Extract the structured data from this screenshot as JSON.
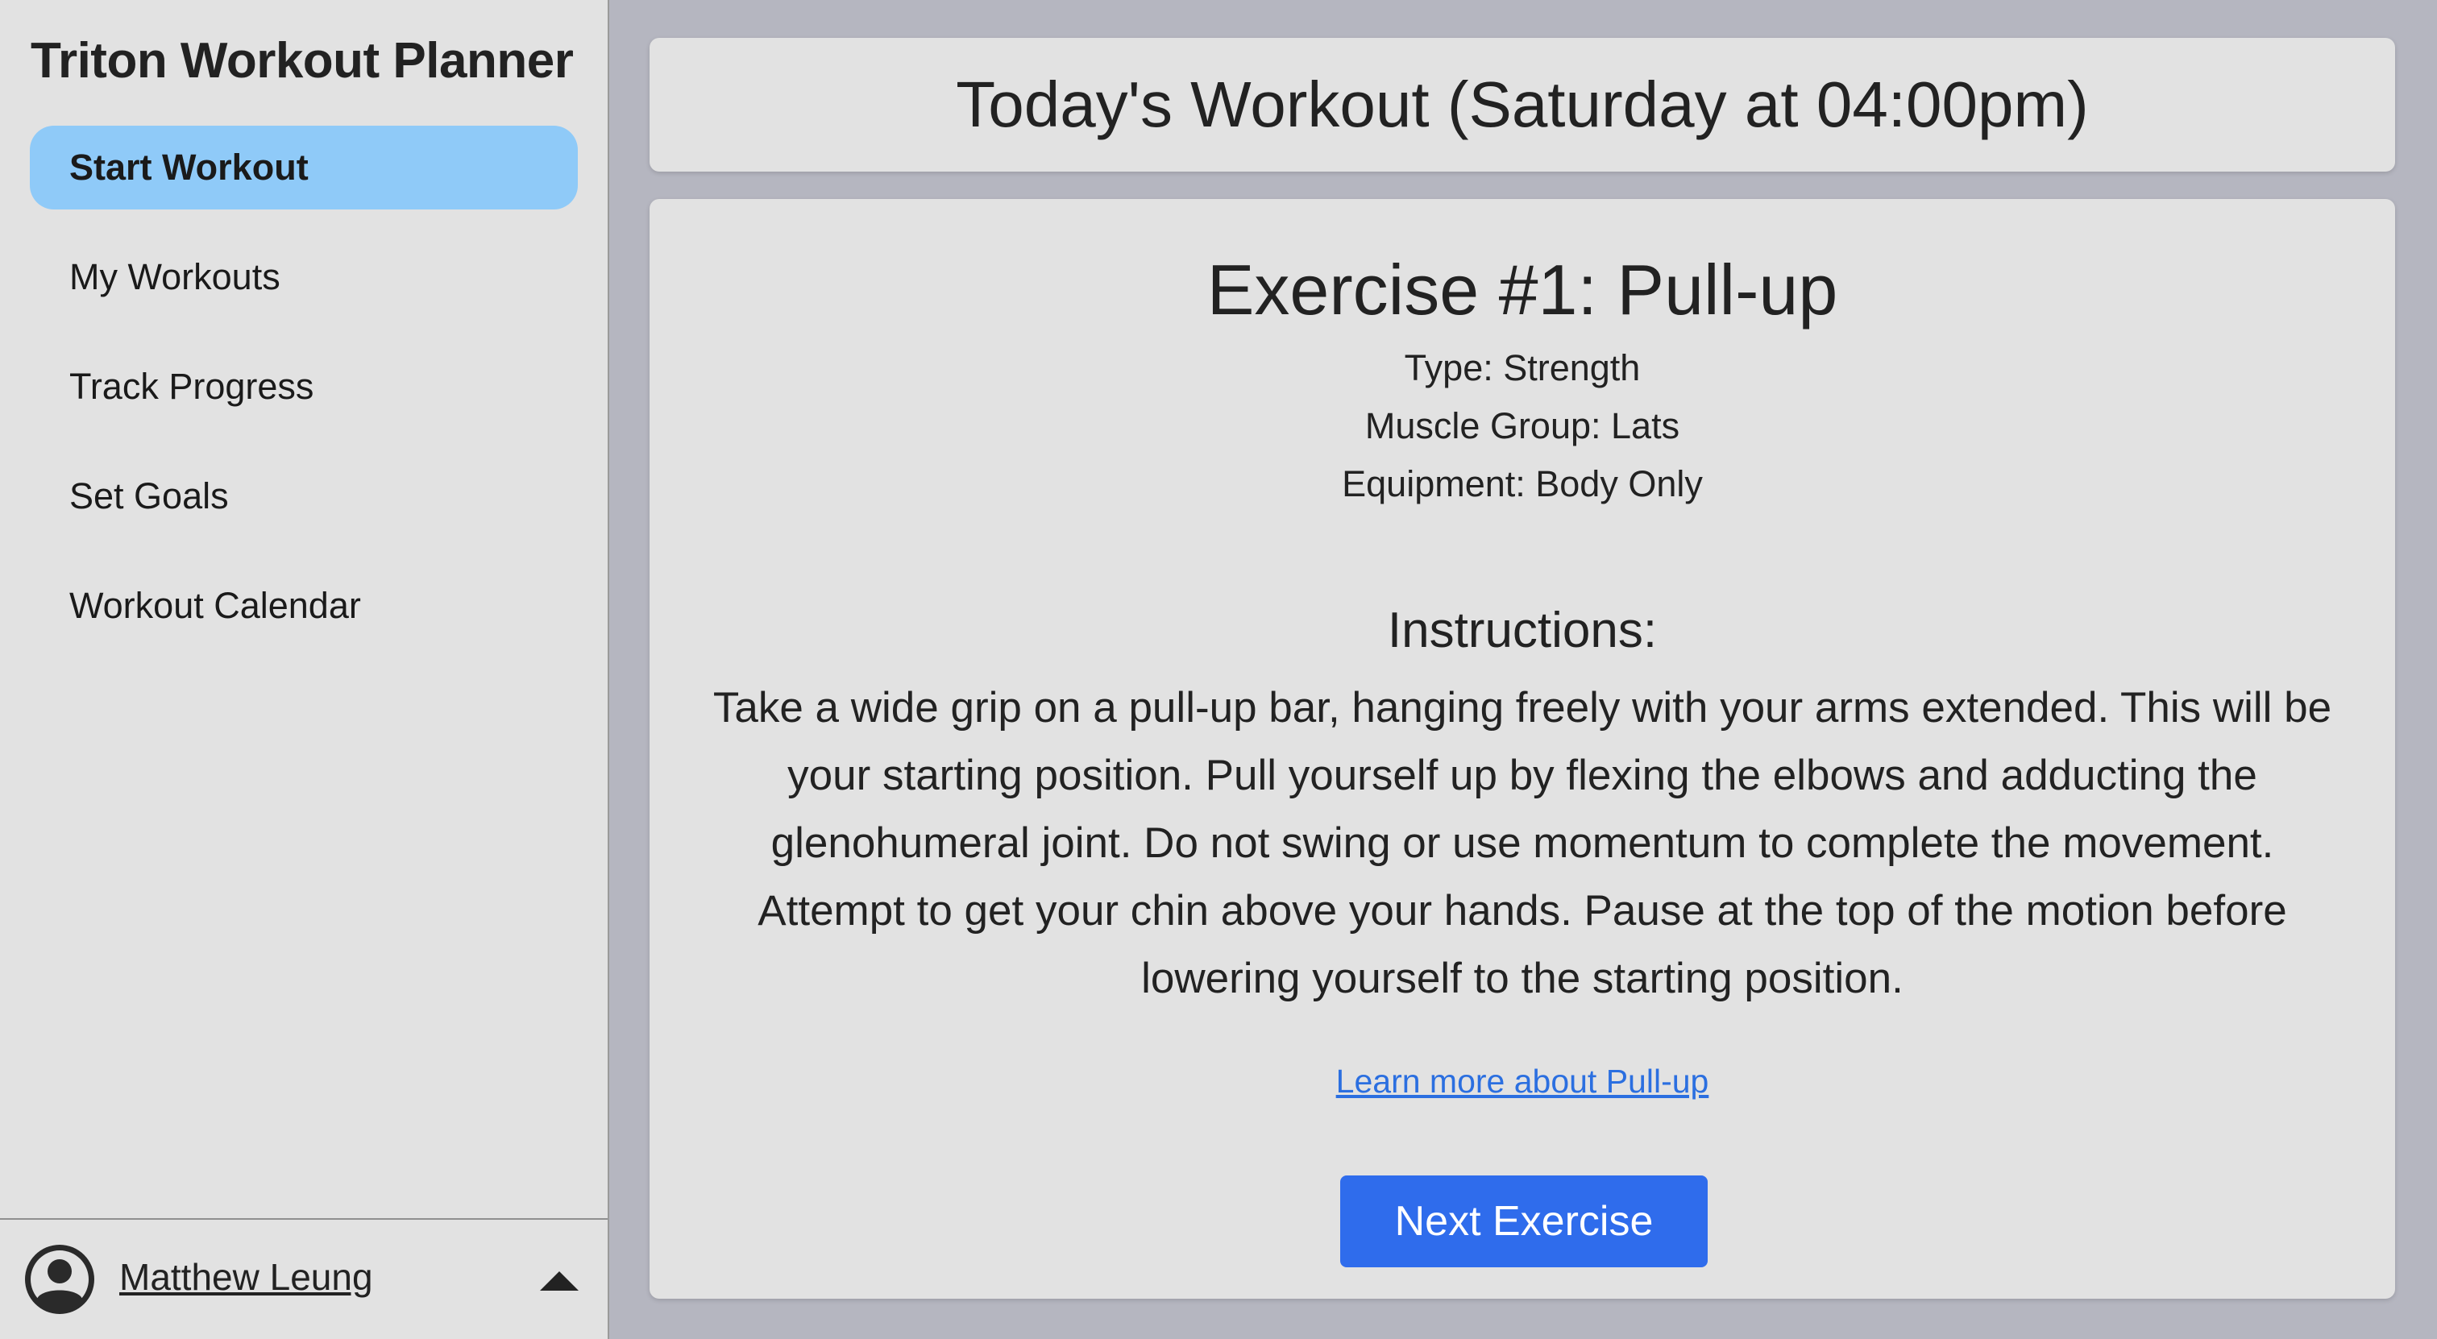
{
  "sidebar": {
    "app_title": "Triton Workout Planner",
    "items": [
      {
        "label": "Start Workout",
        "active": true
      },
      {
        "label": "My Workouts",
        "active": false
      },
      {
        "label": "Track Progress",
        "active": false
      },
      {
        "label": "Set Goals",
        "active": false
      },
      {
        "label": "Workout Calendar",
        "active": false
      }
    ],
    "user": {
      "name": "Matthew Leung",
      "avatar_icon": "user-circle-icon",
      "menu_icon": "caret-up-icon"
    }
  },
  "header": {
    "title": "Today's Workout (Saturday at 04:00pm)"
  },
  "exercise": {
    "title": "Exercise #1: Pull-up",
    "type": "Type: Strength",
    "muscle_group": "Muscle Group: Lats",
    "equipment": "Equipment: Body Only",
    "instructions_heading": "Instructions:",
    "instructions": "Take a wide grip on a pull-up bar, hanging freely with your arms extended. This will be your starting position. Pull yourself up by flexing the elbows and adducting the glenohumeral joint. Do not swing or use momentum to complete the movement. Attempt to get your chin above your hands. Pause at the top of the motion before lowering yourself to the starting position.",
    "learn_more_link": "Learn more about Pull-up",
    "next_button": "Next Exercise"
  },
  "colors": {
    "active_nav": "#8fcaf8",
    "primary_button": "#2f6cec",
    "link": "#2b6fe0",
    "background": "#b5b6c0",
    "card": "#e2e2e2"
  }
}
